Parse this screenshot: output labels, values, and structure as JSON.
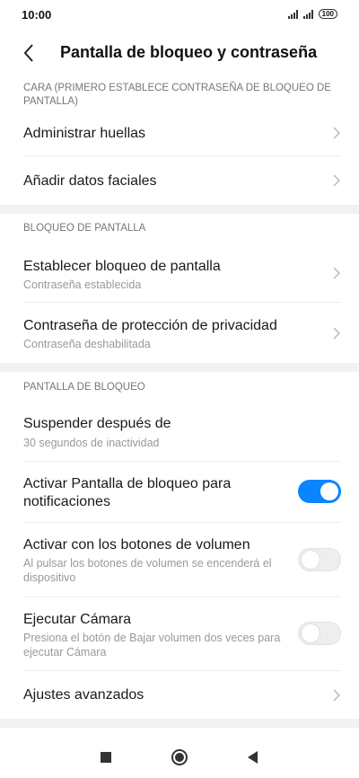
{
  "status": {
    "time": "10:00",
    "battery": "100"
  },
  "header": {
    "title": "Pantalla de bloqueo y contraseña"
  },
  "sections": {
    "face": {
      "header": "CARA (PRIMERO ESTABLECE CONTRASEÑA DE BLOQUEO DE PANTALLA)",
      "items": [
        {
          "title": "Administrar huellas"
        },
        {
          "title": "Añadir datos faciales"
        }
      ]
    },
    "screen_lock": {
      "header": "BLOQUEO DE PANTALLA",
      "items": [
        {
          "title": "Establecer bloqueo de pantalla",
          "subtitle": "Contraseña establecida"
        },
        {
          "title": "Contraseña de protección de privacidad",
          "subtitle": "Contraseña deshabilitada"
        }
      ]
    },
    "lock_screen": {
      "header": "PANTALLA DE BLOQUEO",
      "items": [
        {
          "title": "Suspender después de",
          "subtitle": "30 segundos de inactividad"
        },
        {
          "title": "Activar Pantalla de bloqueo para notificaciones",
          "toggle": true
        },
        {
          "title": "Activar con los botones de volumen",
          "subtitle": "Al pulsar los botones de volumen se encenderá el dispositivo",
          "toggle": false
        },
        {
          "title": "Ejecutar Cámara",
          "subtitle": "Presiona el botón de Bajar volumen dos veces para ejecutar Cámara",
          "toggle": false
        },
        {
          "title": "Ajustes avanzados"
        }
      ]
    }
  },
  "colors": {
    "accent": "#0a84ff",
    "section_gap": "#f2f2f2",
    "subtitle": "#999999"
  },
  "icons": {
    "back": "chevron-left-icon",
    "row_arrow": "chevron-right-icon",
    "nav_recent": "square-icon",
    "nav_home": "circle-icon",
    "nav_back": "triangle-left-icon"
  }
}
